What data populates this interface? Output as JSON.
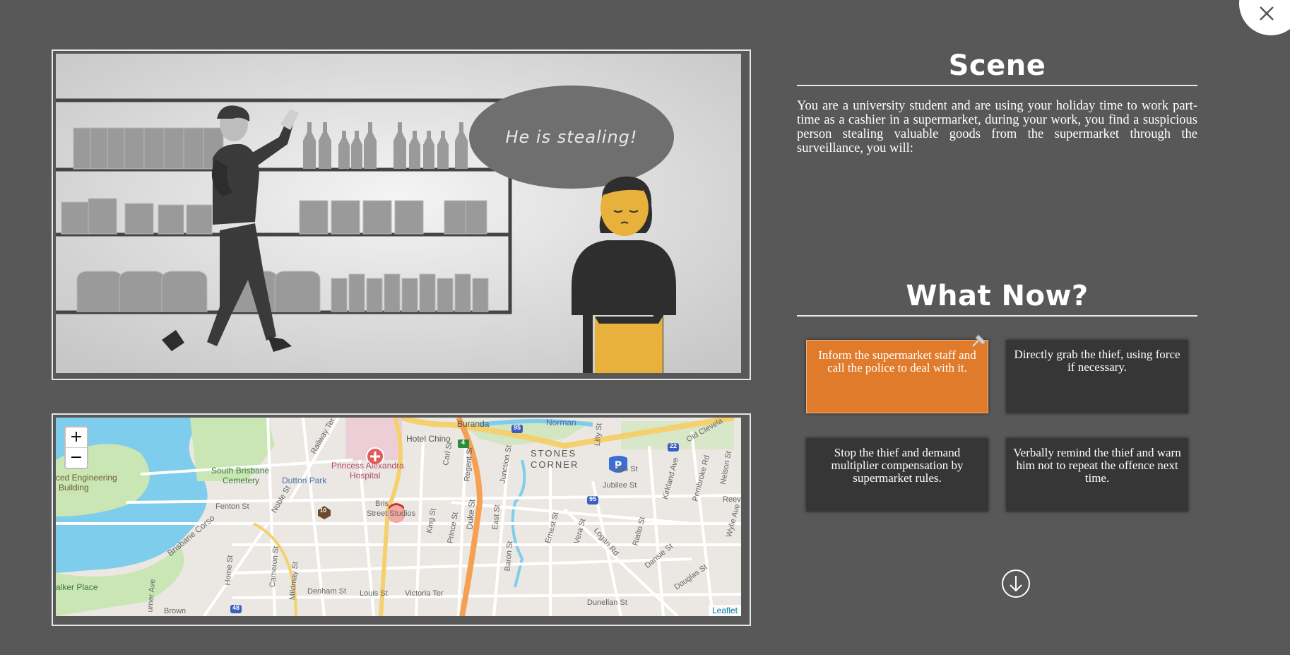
{
  "scene": {
    "heading": "Scene",
    "speech_bubble": "He is stealing!",
    "description": "You are a university student and are using your holiday time to work part-time as a cashier in a supermarket, during your work, you find a suspicious person stealing valuable goods from the supermarket through the surveillance, you will:"
  },
  "what_now": {
    "heading": "What Now?",
    "choices": [
      {
        "label": "Inform the supermarket staff and call the police to deal with it.",
        "selected": true
      },
      {
        "label": "Directly grab the thief, using force if necessary.",
        "selected": false
      },
      {
        "label": "Stop the thief and demand multiplier compensation by supermarket rules.",
        "selected": false
      },
      {
        "label": "Verbally remind the thief and warn him not to repeat the offence next time.",
        "selected": false
      }
    ]
  },
  "map": {
    "zoom_in": "+",
    "zoom_out": "−",
    "attribution": "Leaflet",
    "labels": {
      "buranda": "Buranda",
      "normanby": "Norman",
      "hotel_chino": "Hotel Chino",
      "hospital": "Princess Alexandra",
      "hospital2": "Hospital",
      "south_brisbane_cemetery": "South Brisbane",
      "cemetery": "Cemetery",
      "dutton_park": "Dutton Park",
      "stones": "STONES",
      "corner": "CORNER",
      "ellis": "Ellis St",
      "jubilee": "Jubilee St",
      "old_cleveland": "Old Clevela",
      "engineering": "ced Engineering",
      "building": "Building",
      "fenton": "Fenton St",
      "noble": "Noble St",
      "brisbane_corso": "Brisbane Corso",
      "brisbane_street": "Bris",
      "street_studios": "Street Studios",
      "king": "King St",
      "prince": "Prince St",
      "duke": "Duke St",
      "east": "East St",
      "baron": "Baron St",
      "regent": "Regent St",
      "junction": "Junction St",
      "carl": "Carl St",
      "ernest": "Ernest St",
      "vera": "Vera St",
      "logan": "Logan Rd",
      "rialto": "Rialto St",
      "dansie": "Dansie St",
      "douglas": "Douglas St",
      "dunellan": "Dunellan St",
      "kirkland": "Kirkland Ave",
      "pembroke": "Pembroke Rd",
      "nelson": "Nelson St",
      "wylie": "Wylie Ave",
      "lilly": "Lilly St",
      "railway": "Railway Ter",
      "home": "Home St",
      "cameron": "Cameron St",
      "mildmay": "Mildmay St",
      "denham": "Denham St",
      "louis": "Louis St",
      "victoria": "Victoria Ter",
      "walker": "alker Place",
      "turner": "urner Ave",
      "brown": "Brown",
      "reeve": "Reev",
      "shield_95": "95",
      "shield_95b": "95",
      "shield_22": "22",
      "shield_4": "4",
      "shield_10": "10",
      "shield_48": "48"
    }
  },
  "colors": {
    "background": "#585858",
    "selected_choice": "#e07b2c",
    "choice": "#363636"
  },
  "icons": {
    "close": "close-icon",
    "down": "arrow-down-circle-icon",
    "pin": "pin-icon"
  }
}
